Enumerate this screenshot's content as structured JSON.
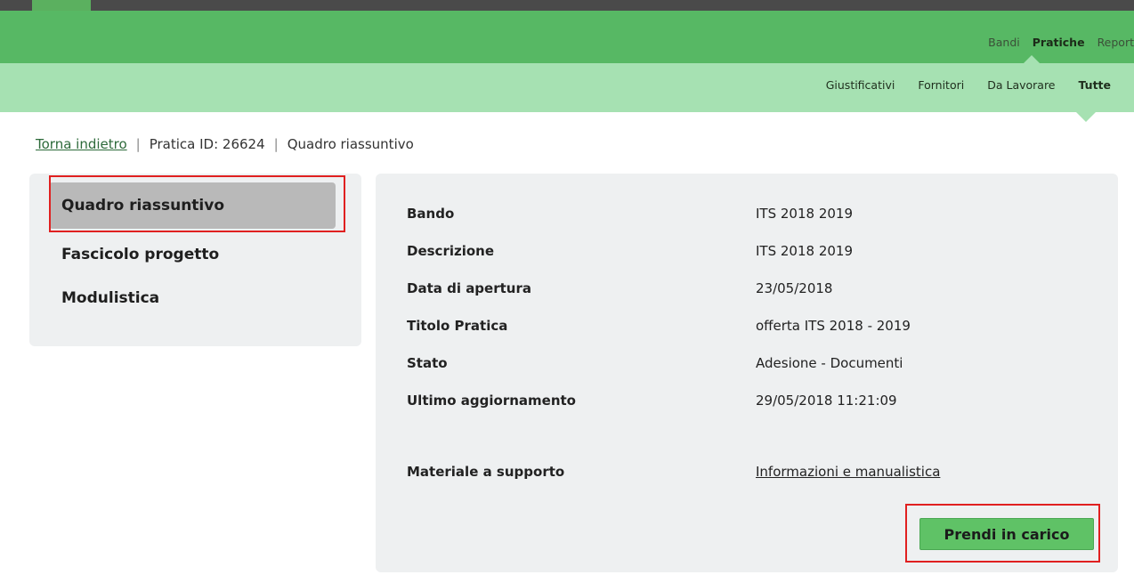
{
  "top_nav": {
    "items": [
      {
        "label": "Bandi"
      },
      {
        "label": "Pratiche",
        "active": true
      },
      {
        "label": "Report"
      }
    ]
  },
  "sub_nav": {
    "items": [
      {
        "label": "Giustificativi"
      },
      {
        "label": "Fornitori"
      },
      {
        "label": "Da Lavorare"
      },
      {
        "label": "Tutte",
        "active": true
      }
    ]
  },
  "breadcrumb": {
    "back_label": "Torna indietro",
    "pratica_id": "Pratica ID: 26624",
    "current": "Quadro riassuntivo",
    "separator": "|"
  },
  "sidebar": {
    "items": [
      {
        "label": "Quadro riassuntivo",
        "active": true
      },
      {
        "label": "Fascicolo progetto"
      },
      {
        "label": "Modulistica"
      }
    ]
  },
  "details": {
    "rows": [
      {
        "label": "Bando",
        "value": "ITS 2018 2019"
      },
      {
        "label": "Descrizione",
        "value": "ITS 2018 2019"
      },
      {
        "label": "Data di apertura",
        "value": "23/05/2018"
      },
      {
        "label": "Titolo Pratica",
        "value": "offerta ITS 2018 - 2019"
      },
      {
        "label": "Stato",
        "value": "Adesione - Documenti"
      },
      {
        "label": "Ultimo aggiornamento",
        "value": "29/05/2018 11:21:09"
      }
    ],
    "support": {
      "label": "Materiale a supporto",
      "value": "Informazioni e manualistica"
    }
  },
  "actions": {
    "take_charge_label": "Prendi in carico"
  },
  "colors": {
    "nav_green": "#57b864",
    "subnav_green": "#a6e1b2",
    "button_green": "#5fc266",
    "highlight_red": "#e02020"
  }
}
